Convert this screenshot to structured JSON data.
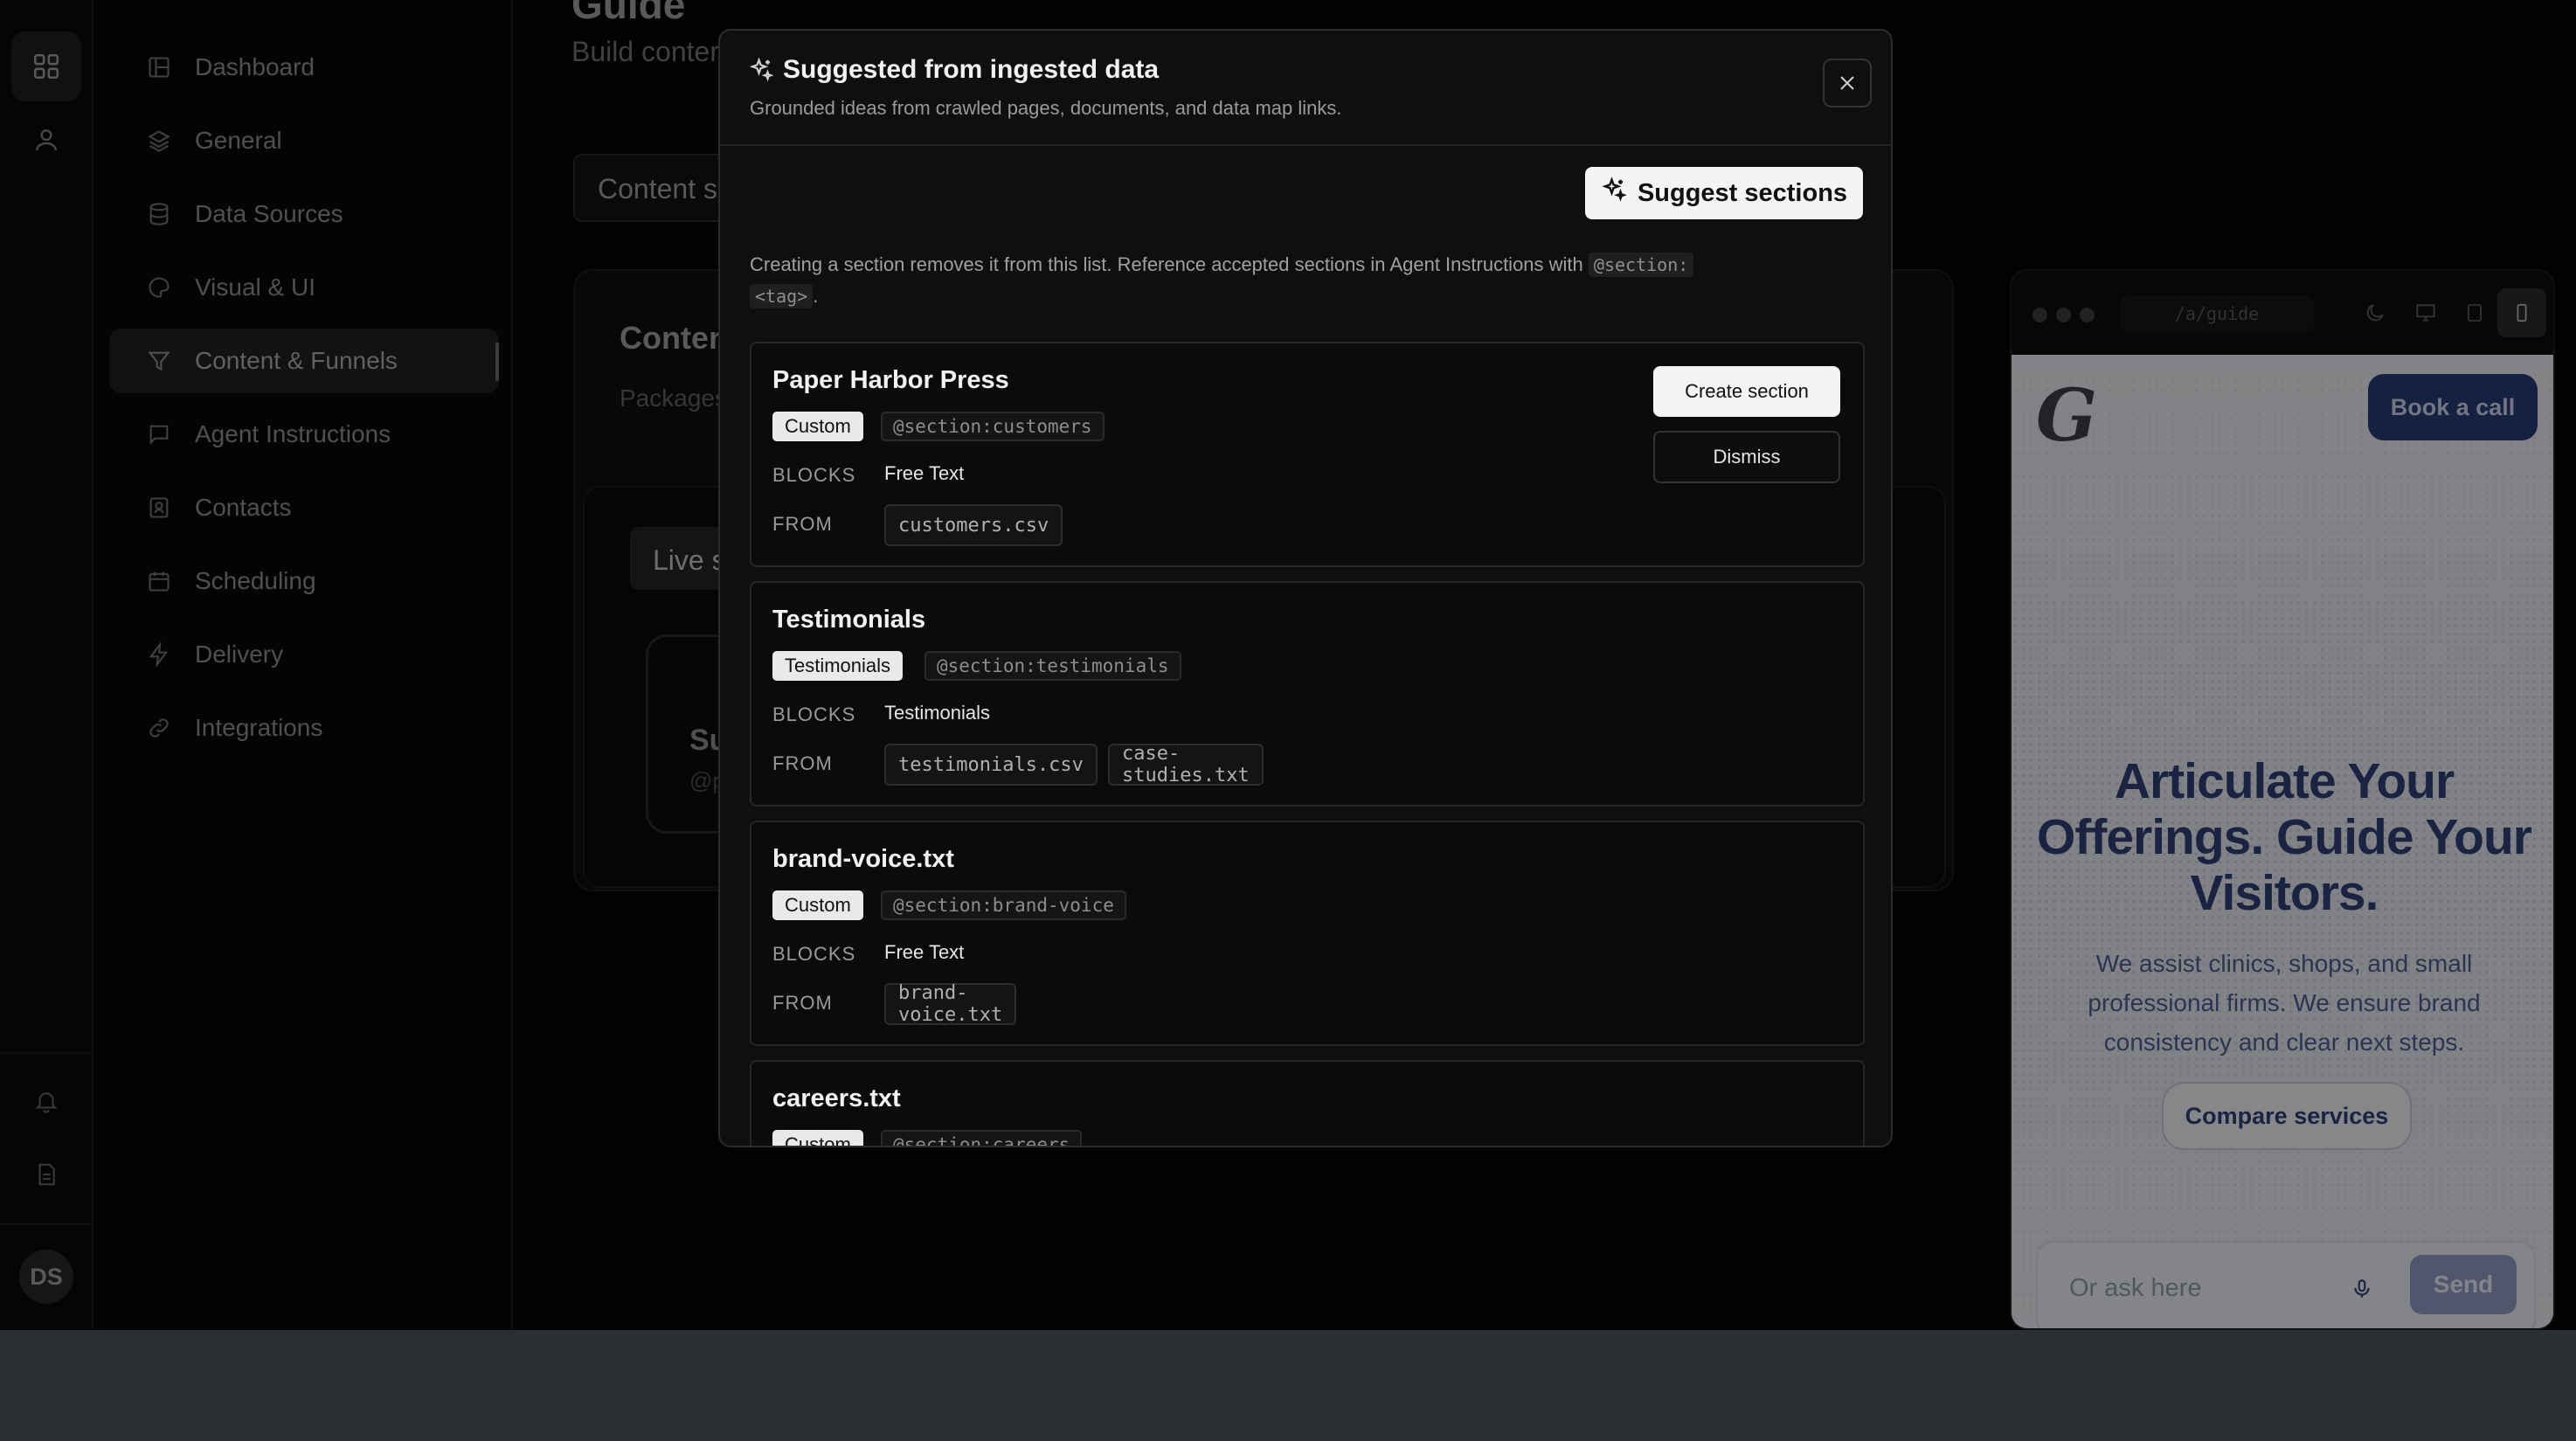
{
  "sidebar": {
    "items": [
      {
        "label": "Dashboard",
        "icon": "dashboard-icon"
      },
      {
        "label": "General",
        "icon": "layers-icon"
      },
      {
        "label": "Data Sources",
        "icon": "database-icon"
      },
      {
        "label": "Visual & UI",
        "icon": "palette-icon"
      },
      {
        "label": "Content & Funnels",
        "icon": "funnel-icon",
        "active": true
      },
      {
        "label": "Agent Instructions",
        "icon": "message-icon"
      },
      {
        "label": "Contacts",
        "icon": "contact-icon"
      },
      {
        "label": "Scheduling",
        "icon": "calendar-icon"
      },
      {
        "label": "Delivery",
        "icon": "bolt-icon"
      },
      {
        "label": "Integrations",
        "icon": "link-icon"
      }
    ],
    "avatar_initials": "DS"
  },
  "background": {
    "page_title": "Guide",
    "page_desc": "Build conter conversatio",
    "selector_label": "Content s",
    "card_title": "Conten",
    "card_sub": "Packages",
    "live_tab": "Live s",
    "mini_card_title": "Su",
    "mini_card_sub": "@p"
  },
  "preview": {
    "url": "/a/guide",
    "logo": "G",
    "book_call": "Book a call",
    "headline": "Articulate Your Offerings. Guide Your Visitors.",
    "body": "We assist clinics, shops, and small professional firms. We ensure brand consistency and clear next steps.",
    "compare": "Compare services",
    "chat_placeholder": "Or ask here",
    "send": "Send"
  },
  "modal": {
    "title": "Suggested from ingested data",
    "subtitle": "Grounded ideas from crawled pages, documents, and data map links.",
    "suggest_button": "Suggest sections",
    "note_prefix": "Creating a section removes it from this list. Reference accepted sections in Agent Instructions with",
    "note_code1": "@section:",
    "note_code2": "<tag>",
    "note_suffix": ".",
    "blocks_label": "BLOCKS",
    "from_label": "FROM",
    "create_label": "Create section",
    "dismiss_label": "Dismiss",
    "suggestions": [
      {
        "title": "Paper Harbor Press",
        "type": "Custom",
        "tag": "@section:customers",
        "blocks": "Free Text",
        "from": [
          "customers.csv"
        ]
      },
      {
        "title": "Testimonials",
        "type": "Testimonials",
        "tag": "@section:testimonials",
        "blocks": "Testimonials",
        "from": [
          "testimonials.csv",
          "case-studies.txt"
        ]
      },
      {
        "title": "brand-voice.txt",
        "type": "Custom",
        "tag": "@section:brand-voice",
        "blocks": "Free Text",
        "from": [
          "brand-voice.txt"
        ]
      },
      {
        "title": "careers.txt",
        "type": "Custom",
        "tag": "@section:careers"
      }
    ]
  },
  "colors": {
    "accent_navy": "#2e3f72",
    "book_call_bg": "#27376e",
    "modal_bg": "#0f0f0f"
  }
}
